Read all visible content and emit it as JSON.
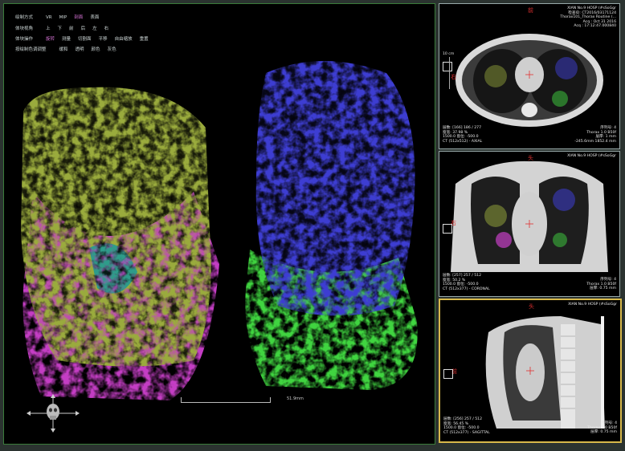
{
  "menu": {
    "row1": {
      "label": "绘制方式",
      "items": [
        "VR",
        "MIP",
        "剖面",
        "表面"
      ],
      "selected": 2
    },
    "row2": {
      "label": "体块视角",
      "items": [
        "上",
        "下",
        "前",
        "后",
        "左",
        "右"
      ]
    },
    "row3": {
      "label": "体块操作",
      "items": [
        "旋转",
        "测量",
        "切割面",
        "平移",
        "自由缩放",
        "重置"
      ],
      "selected": 0
    },
    "row4": {
      "label": "按绘制色调调整",
      "items": [
        "缓和",
        "透明",
        "颜色",
        "灰色"
      ]
    }
  },
  "viewport": {
    "scale_label": "51.9mm",
    "colors": {
      "olive": "#9aab3c",
      "magenta": "#c43ec4",
      "blue": "#3e3ed2",
      "green": "#3fd43f",
      "teal": "#2f9c8a"
    }
  },
  "panels": [
    {
      "id": "axial",
      "orient_top": "前",
      "orient_left": "右",
      "scale": "10 cm",
      "top_right": [
        "XIAN No.9 HOSP (#sSoGgr",
        "检查ID: CT2016/03171124",
        "Thorax101_Thorax Routine (...",
        "Acq : Oct 31 2016",
        "Acq : 17:12:47.000840"
      ],
      "bottom_left": [
        "层数:     [166] 186 / 277",
        "窗宽:     37.98 %",
        "        1500.0  窗位:  -500.0",
        "CT (512x512) - AXIAL"
      ],
      "bottom_right": [
        "序列号:  4",
        "Thorax  1.0  B50f",
        "层厚:     1 mm",
        "-245.6mm  1852.4 mm"
      ]
    },
    {
      "id": "coronal",
      "orient_top": "头",
      "orient_left": "右",
      "top_right": [
        "XIAN No.9 HOSP (#sSoGgr"
      ],
      "bottom_left": [
        "层数:     [257] 257 / 512",
        "窗宽:     50.2 %",
        "        1500.0  窗位:  -500.0",
        "CT (512x377) - CORONAL"
      ],
      "bottom_right": [
        "序列号:  4",
        "Thorax  1.0  B50f",
        "层厚:     0.75 mm"
      ]
    },
    {
      "id": "sagittal",
      "orient_top": "头",
      "orient_left": "前",
      "top_right": [
        "XIAN No.9 HOSP (#sSoGgr"
      ],
      "bottom_left": [
        "层数:     [256] 257 / 512",
        "窗宽:     56.45 %",
        "        1500.0  窗位:  -500.0",
        "CT (512x377) - SAGITTAL"
      ],
      "bottom_right": [
        "序列号:  4",
        "Thorax  1.0  B50f",
        "层厚:     0.75 mm"
      ]
    }
  ]
}
